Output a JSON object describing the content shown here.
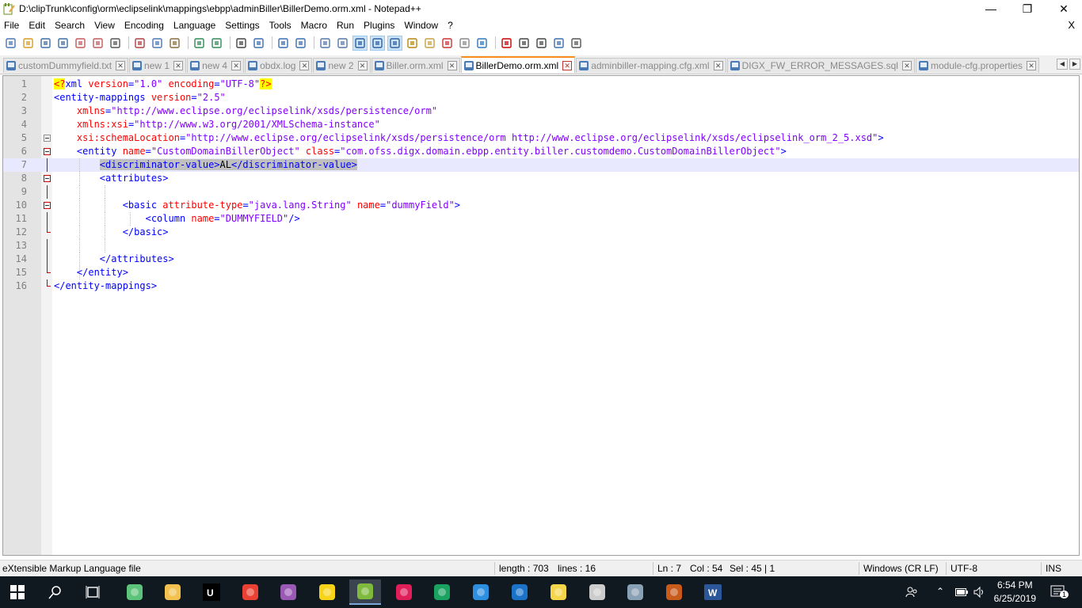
{
  "window": {
    "title": "D:\\clipTrunk\\config\\orm\\eclipselink\\mappings\\ebpp\\adminBiller\\BillerDemo.orm.xml - Notepad++",
    "minimize_glyph": "—",
    "maximize_glyph": "❐",
    "close_glyph": "✕"
  },
  "menu": {
    "items": [
      "File",
      "Edit",
      "Search",
      "View",
      "Encoding",
      "Language",
      "Settings",
      "Tools",
      "Macro",
      "Run",
      "Plugins",
      "Window",
      "?"
    ],
    "close_doc": "X"
  },
  "toolbar": {
    "icons": [
      "new-file-icon",
      "open-file-icon",
      "save-icon",
      "save-all-icon",
      "close-icon",
      "close-all-icon",
      "print-icon",
      "cut-icon",
      "copy-icon",
      "paste-icon",
      "undo-icon",
      "redo-icon",
      "find-icon",
      "replace-icon",
      "zoom-in-icon",
      "zoom-out-icon",
      "sync-vertical-icon",
      "sync-horizontal-icon",
      "word-wrap-icon",
      "show-all-chars-icon",
      "indent-guide-icon",
      "udl-icon",
      "doc-map-icon",
      "function-list-icon",
      "folder-workspace-icon",
      "monitoring-icon",
      "record-macro-icon",
      "stop-macro-icon",
      "play-macro-icon",
      "play-multiple-macro-icon",
      "save-macro-icon"
    ]
  },
  "tabs": [
    {
      "label": "customDummyfield.txt",
      "active": false,
      "dirty": false
    },
    {
      "label": "new 1",
      "active": false,
      "dirty": false
    },
    {
      "label": "new 4",
      "active": false,
      "dirty": false
    },
    {
      "label": "obdx.log",
      "active": false,
      "dirty": false
    },
    {
      "label": "new 2",
      "active": false,
      "dirty": false
    },
    {
      "label": "Biller.orm.xml",
      "active": false,
      "dirty": false
    },
    {
      "label": "BillerDemo.orm.xml",
      "active": true,
      "dirty": false
    },
    {
      "label": "adminbiller-mapping.cfg.xml",
      "active": false,
      "dirty": false
    },
    {
      "label": "DIGX_FW_ERROR_MESSAGES.sql",
      "active": false,
      "dirty": false
    },
    {
      "label": "module-cfg.properties",
      "active": false,
      "dirty": false
    }
  ],
  "editor": {
    "current_line": 7,
    "lines": [
      {
        "n": "1",
        "tokens": [
          [
            "pi",
            "<?"
          ],
          [
            "tag",
            "xml "
          ],
          [
            "attr",
            "version"
          ],
          [
            "tag",
            "="
          ],
          [
            "val",
            "\"1.0\""
          ],
          [
            "tag",
            " "
          ],
          [
            "attr",
            "encoding"
          ],
          [
            "tag",
            "="
          ],
          [
            "val",
            "\"UTF-8\""
          ],
          [
            "pi",
            "?>"
          ]
        ]
      },
      {
        "n": "2",
        "tokens": [
          [
            "tag",
            "<entity-mappings "
          ],
          [
            "attr",
            "version"
          ],
          [
            "tag",
            "="
          ],
          [
            "val",
            "\"2.5\""
          ]
        ]
      },
      {
        "n": "3",
        "tokens": [
          [
            "tag",
            "    "
          ],
          [
            "attr",
            "xmlns"
          ],
          [
            "tag",
            "="
          ],
          [
            "val",
            "\"http://www.eclipse.org/eclipselink/xsds/persistence/orm\""
          ]
        ]
      },
      {
        "n": "4",
        "tokens": [
          [
            "tag",
            "    "
          ],
          [
            "attr",
            "xmlns:xsi"
          ],
          [
            "tag",
            "="
          ],
          [
            "val",
            "\"http://www.w3.org/2001/XMLSchema-instance\""
          ]
        ]
      },
      {
        "n": "5",
        "tokens": [
          [
            "tag",
            "    "
          ],
          [
            "attr",
            "xsi:schemaLocation"
          ],
          [
            "tag",
            "="
          ],
          [
            "val",
            "\"http://www.eclipse.org/eclipselink/xsds/persistence/orm http://www.eclipse.org/eclipselink/xsds/eclipselink_orm_2_5.xsd\""
          ],
          [
            "tag",
            ">"
          ]
        ]
      },
      {
        "n": "6",
        "tokens": [
          [
            "tag",
            "    <entity "
          ],
          [
            "attr",
            "name"
          ],
          [
            "tag",
            "="
          ],
          [
            "val",
            "\"CustomDomainBillerObject\""
          ],
          [
            "tag",
            " "
          ],
          [
            "attr",
            "class"
          ],
          [
            "tag",
            "="
          ],
          [
            "val",
            "\"com.ofss.digx.domain.ebpp.entity.biller.customdemo.CustomDomainBillerObject\""
          ],
          [
            "tag",
            ">"
          ]
        ]
      },
      {
        "n": "7",
        "tokens": [
          [
            "tag",
            "        "
          ],
          [
            "seltag",
            "<discriminator-value>"
          ],
          [
            "seltext",
            "AL"
          ],
          [
            "seltag",
            "</discriminator-value>"
          ]
        ]
      },
      {
        "n": "8",
        "tokens": [
          [
            "tag",
            "        <attributes>"
          ]
        ]
      },
      {
        "n": "9",
        "tokens": [
          [
            "tag",
            ""
          ]
        ]
      },
      {
        "n": "10",
        "tokens": [
          [
            "tag",
            "            <basic "
          ],
          [
            "attr",
            "attribute-type"
          ],
          [
            "tag",
            "="
          ],
          [
            "val",
            "\"java.lang.String\""
          ],
          [
            "tag",
            " "
          ],
          [
            "attr",
            "name"
          ],
          [
            "tag",
            "="
          ],
          [
            "val",
            "\"dummyField\""
          ],
          [
            "tag",
            ">"
          ]
        ]
      },
      {
        "n": "11",
        "tokens": [
          [
            "tag",
            "                <column "
          ],
          [
            "attr",
            "name"
          ],
          [
            "tag",
            "="
          ],
          [
            "val",
            "\"DUMMYFIELD\""
          ],
          [
            "tag",
            "/>"
          ]
        ]
      },
      {
        "n": "12",
        "tokens": [
          [
            "tag",
            "            </basic>"
          ]
        ]
      },
      {
        "n": "13",
        "tokens": [
          [
            "tag",
            ""
          ]
        ]
      },
      {
        "n": "14",
        "tokens": [
          [
            "tag",
            "        </attributes>"
          ]
        ]
      },
      {
        "n": "15",
        "tokens": [
          [
            "tag",
            "    </entity>"
          ]
        ]
      },
      {
        "n": "16",
        "tokens": [
          [
            "tag",
            "</entity-mappings>"
          ]
        ]
      }
    ]
  },
  "status": {
    "file_type": "eXtensible Markup Language file",
    "length": "length : 703",
    "lines": "lines : 16",
    "ln": "Ln : 7",
    "col": "Col : 54",
    "sel": "Sel : 45 | 1",
    "eol": "Windows (CR LF)",
    "encoding": "UTF-8",
    "mode": "INS"
  },
  "taskbar": {
    "apps": [
      "start-icon",
      "search-icon",
      "task-view-icon",
      "atom-icon",
      "file-explorer-icon",
      "intellij-icon",
      "chrome-icon",
      "app-icon",
      "sticky-notes-icon",
      "notepadpp-icon",
      "slack-icon",
      "media-player-icon",
      "vscode-icon",
      "outlook-icon",
      "bulb-icon",
      "terminal-icon",
      "security-icon",
      "game-icon",
      "word-icon"
    ],
    "time": "6:54 PM",
    "date": "6/25/2019",
    "notification_count": "1"
  }
}
